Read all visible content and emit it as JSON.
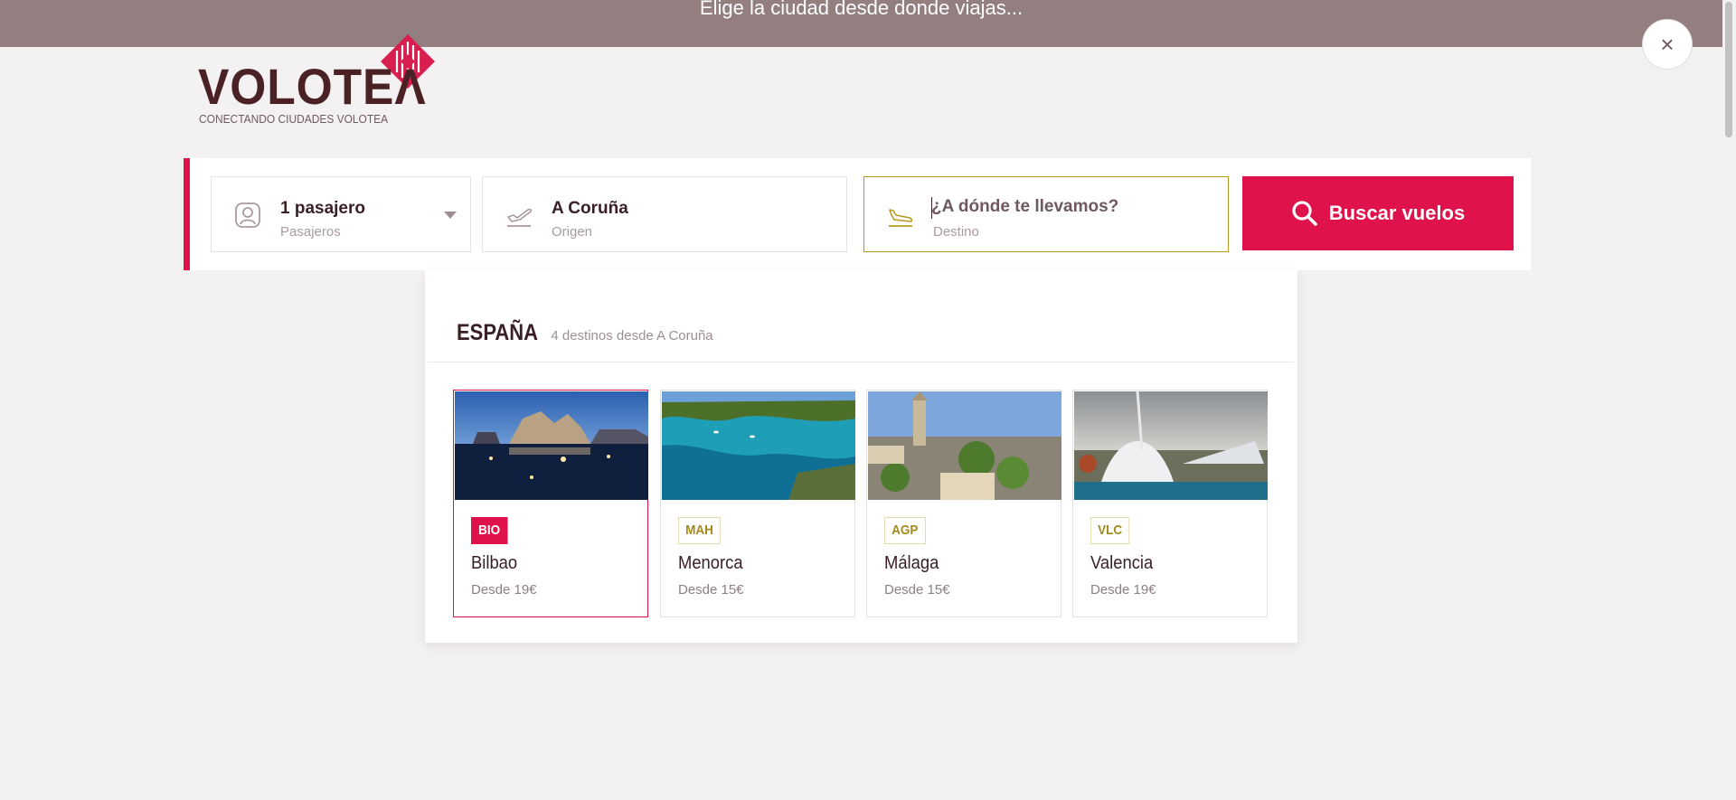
{
  "topbar": {
    "message": "Elige la ciudad desde donde viajas..."
  },
  "close": {
    "symbol": "×"
  },
  "logo": {
    "wordmark": "VOLOTEΛ",
    "tagline": "CONECTANDO CIUDADES VOLOTEA"
  },
  "search": {
    "passengers": {
      "value": "1 pasajero",
      "label": "Pasajeros",
      "icon": "passenger-icon"
    },
    "origin": {
      "value": "A Coruña",
      "label": "Origen",
      "icon": "takeoff-icon"
    },
    "destination": {
      "placeholder": "¿A dónde te llevamos?",
      "label": "Destino",
      "icon": "landing-icon"
    },
    "button_label": "Buscar vuelos"
  },
  "dropdown": {
    "region": "ESPAÑA",
    "region_sub": "4 destinos desde A Coruña",
    "destinations": [
      {
        "code": "BIO",
        "name": "Bilbao",
        "price": "Desde 19€"
      },
      {
        "code": "MAH",
        "name": "Menorca",
        "price": "Desde 15€"
      },
      {
        "code": "AGP",
        "name": "Málaga",
        "price": "Desde 15€"
      },
      {
        "code": "VLC",
        "name": "Valencia",
        "price": "Desde 19€"
      }
    ]
  },
  "colors": {
    "brand": "#e0124b",
    "accent_gold": "#b8991f",
    "topbar": "#937e80",
    "text_dark": "#3a2024"
  }
}
